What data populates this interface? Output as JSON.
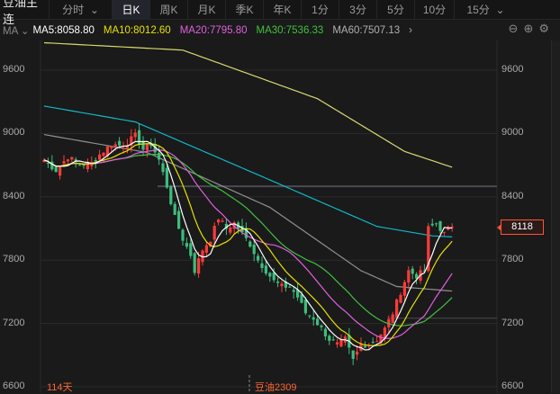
{
  "header": {
    "title": "豆油主连",
    "tabs": [
      "分时",
      "日K",
      "周K",
      "月K",
      "季K",
      "年K",
      "1分",
      "3分",
      "5分",
      "10分",
      "15分"
    ],
    "active": "日K"
  },
  "ma_bar": {
    "selector": "MA",
    "items": [
      {
        "label": "MA5:8058.80",
        "color": "#ffffff"
      },
      {
        "label": "MA10:8012.60",
        "color": "#e8e000"
      },
      {
        "label": "MA20:7795.80",
        "color": "#e060e0"
      },
      {
        "label": "MA30:7536.33",
        "color": "#40c040"
      },
      {
        "label": "MA60:7507.13",
        "color": "#b0b0b0"
      }
    ]
  },
  "footer": {
    "days": "114天",
    "contract": "豆油2309"
  },
  "last_price": "8118",
  "chart_data": {
    "type": "candlestick",
    "yticks": [
      "9600",
      "9000",
      "8400",
      "7800",
      "7200",
      "6600"
    ],
    "ylim": [
      6600,
      9800
    ],
    "candle_count": 104,
    "close_keypoints": [
      [
        0,
        8750
      ],
      [
        3,
        8650
      ],
      [
        6,
        8780
      ],
      [
        9,
        8700
      ],
      [
        12,
        8720
      ],
      [
        14,
        8800
      ],
      [
        17,
        8900
      ],
      [
        20,
        8880
      ],
      [
        23,
        8980
      ],
      [
        25,
        8850
      ],
      [
        27,
        8900
      ],
      [
        29,
        8750
      ],
      [
        31,
        8500
      ],
      [
        33,
        8200
      ],
      [
        35,
        8000
      ],
      [
        37,
        7850
      ],
      [
        38,
        7700
      ],
      [
        40,
        7900
      ],
      [
        42,
        8000
      ],
      [
        44,
        8200
      ],
      [
        46,
        8100
      ],
      [
        48,
        8150
      ],
      [
        50,
        8050
      ],
      [
        52,
        7950
      ],
      [
        54,
        7800
      ],
      [
        56,
        7700
      ],
      [
        58,
        7600
      ],
      [
        60,
        7550
      ],
      [
        62,
        7550
      ],
      [
        64,
        7450
      ],
      [
        66,
        7300
      ],
      [
        68,
        7250
      ],
      [
        70,
        7150
      ],
      [
        72,
        7050
      ],
      [
        74,
        7000
      ],
      [
        76,
        7050
      ],
      [
        78,
        6850
      ],
      [
        80,
        7000
      ],
      [
        82,
        7000
      ],
      [
        84,
        7050
      ],
      [
        86,
        7150
      ],
      [
        88,
        7300
      ],
      [
        90,
        7500
      ],
      [
        92,
        7700
      ],
      [
        94,
        7650
      ],
      [
        96,
        7700
      ],
      [
        97,
        8100
      ],
      [
        99,
        8150
      ],
      [
        101,
        8050
      ],
      [
        103,
        8118
      ]
    ],
    "ma60_keypoints": [
      [
        0,
        8990
      ],
      [
        26,
        8820
      ],
      [
        57,
        8300
      ],
      [
        80,
        7700
      ],
      [
        89,
        7550
      ],
      [
        103,
        7507
      ]
    ],
    "long_ma_cyan_keypoints": [
      [
        0,
        9260
      ],
      [
        23,
        9110
      ],
      [
        57,
        8560
      ],
      [
        84,
        8120
      ],
      [
        98,
        8030
      ],
      [
        103,
        8020
      ]
    ],
    "long_ma_yellow_keypoints": [
      [
        0,
        9860
      ],
      [
        35,
        9790
      ],
      [
        69,
        9330
      ],
      [
        91,
        8830
      ],
      [
        103,
        8680
      ]
    ],
    "ref_lines": [
      8500,
      7250
    ],
    "colors": {
      "up": "#ff3b3b",
      "down": "#3dbd7d",
      "ma5": "#ffffff",
      "ma10": "#e8e000",
      "ma20": "#e060e0",
      "ma30": "#40c040",
      "ma60": "#909090",
      "cyan": "#10b8c8",
      "long": "#d8d870"
    }
  }
}
